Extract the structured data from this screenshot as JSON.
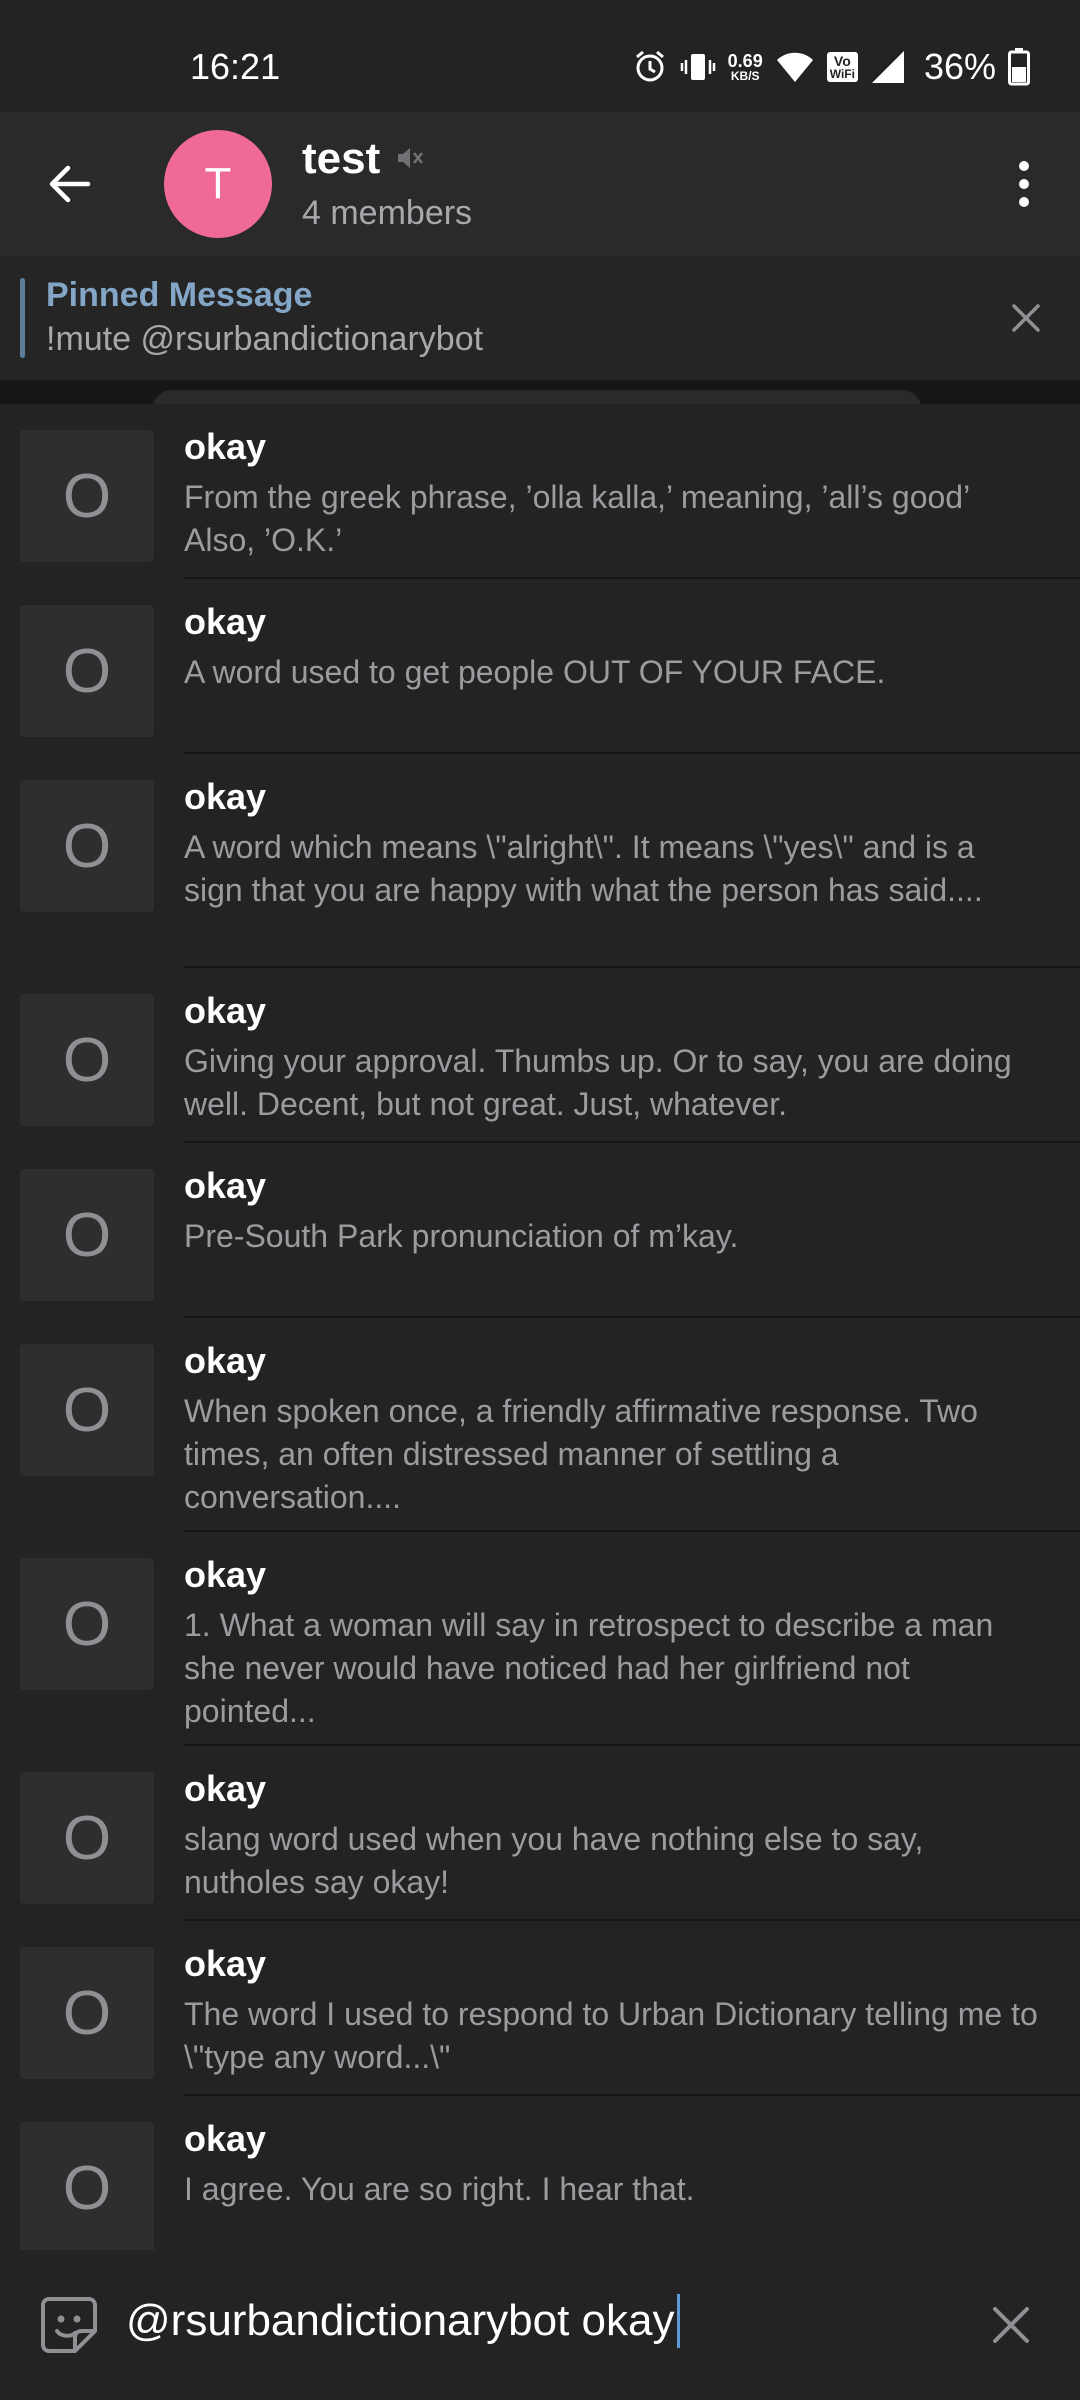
{
  "status_bar": {
    "time": "16:21",
    "net_speed_value": "0.69",
    "net_speed_unit": "KB/S",
    "vowifi_top": "Vo",
    "vowifi_bottom": "WiFi",
    "battery": "36%"
  },
  "header": {
    "avatar_letter": "T",
    "title": "test",
    "subtitle": "4 members",
    "avatar_color": "#f06a96"
  },
  "pinned": {
    "title": "Pinned Message",
    "text": "!mute @rsurbandictionarybot"
  },
  "results": [
    {
      "thumb": "O",
      "title": "okay",
      "desc": "From the greek phrase, ’olla kalla,’ meaning, ’all’s good’ Also, ’O.K.’"
    },
    {
      "thumb": "O",
      "title": "okay",
      "desc": "A word used to get people OUT OF YOUR FACE."
    },
    {
      "thumb": "O",
      "title": "okay",
      "desc": "A word which means \\\"alright\\\". It means \\\"yes\\\" and is a sign that you are happy with what the person has said...."
    },
    {
      "thumb": "O",
      "title": "okay",
      "desc": "Giving your approval. Thumbs up. Or to say, you are doing well. Decent, but not great. Just, whatever."
    },
    {
      "thumb": "O",
      "title": "okay",
      "desc": "Pre-South Park pronunciation of m’kay."
    },
    {
      "thumb": "O",
      "title": "okay",
      "desc": "When spoken once, a friendly affirmative response. Two times, an often distressed manner of settling a conversation...."
    },
    {
      "thumb": "O",
      "title": "okay",
      "desc": "1. What a woman will say in retrospect to describe a man she never would have noticed had her girlfriend not pointed..."
    },
    {
      "thumb": "O",
      "title": "okay",
      "desc": "slang word used when you have nothing else to say, nutholes say okay!"
    },
    {
      "thumb": "O",
      "title": "okay",
      "desc": "The word I used to respond to Urban Dictionary telling me to \\\"type any word...\\\""
    },
    {
      "thumb": "O",
      "title": "okay",
      "desc": "I agree. You are so right. I hear that."
    }
  ],
  "input": {
    "value": "@rsurbandictionarybot okay"
  },
  "colors": {
    "accent": "#5e9bd6",
    "pinned_title": "#84a6c6"
  }
}
